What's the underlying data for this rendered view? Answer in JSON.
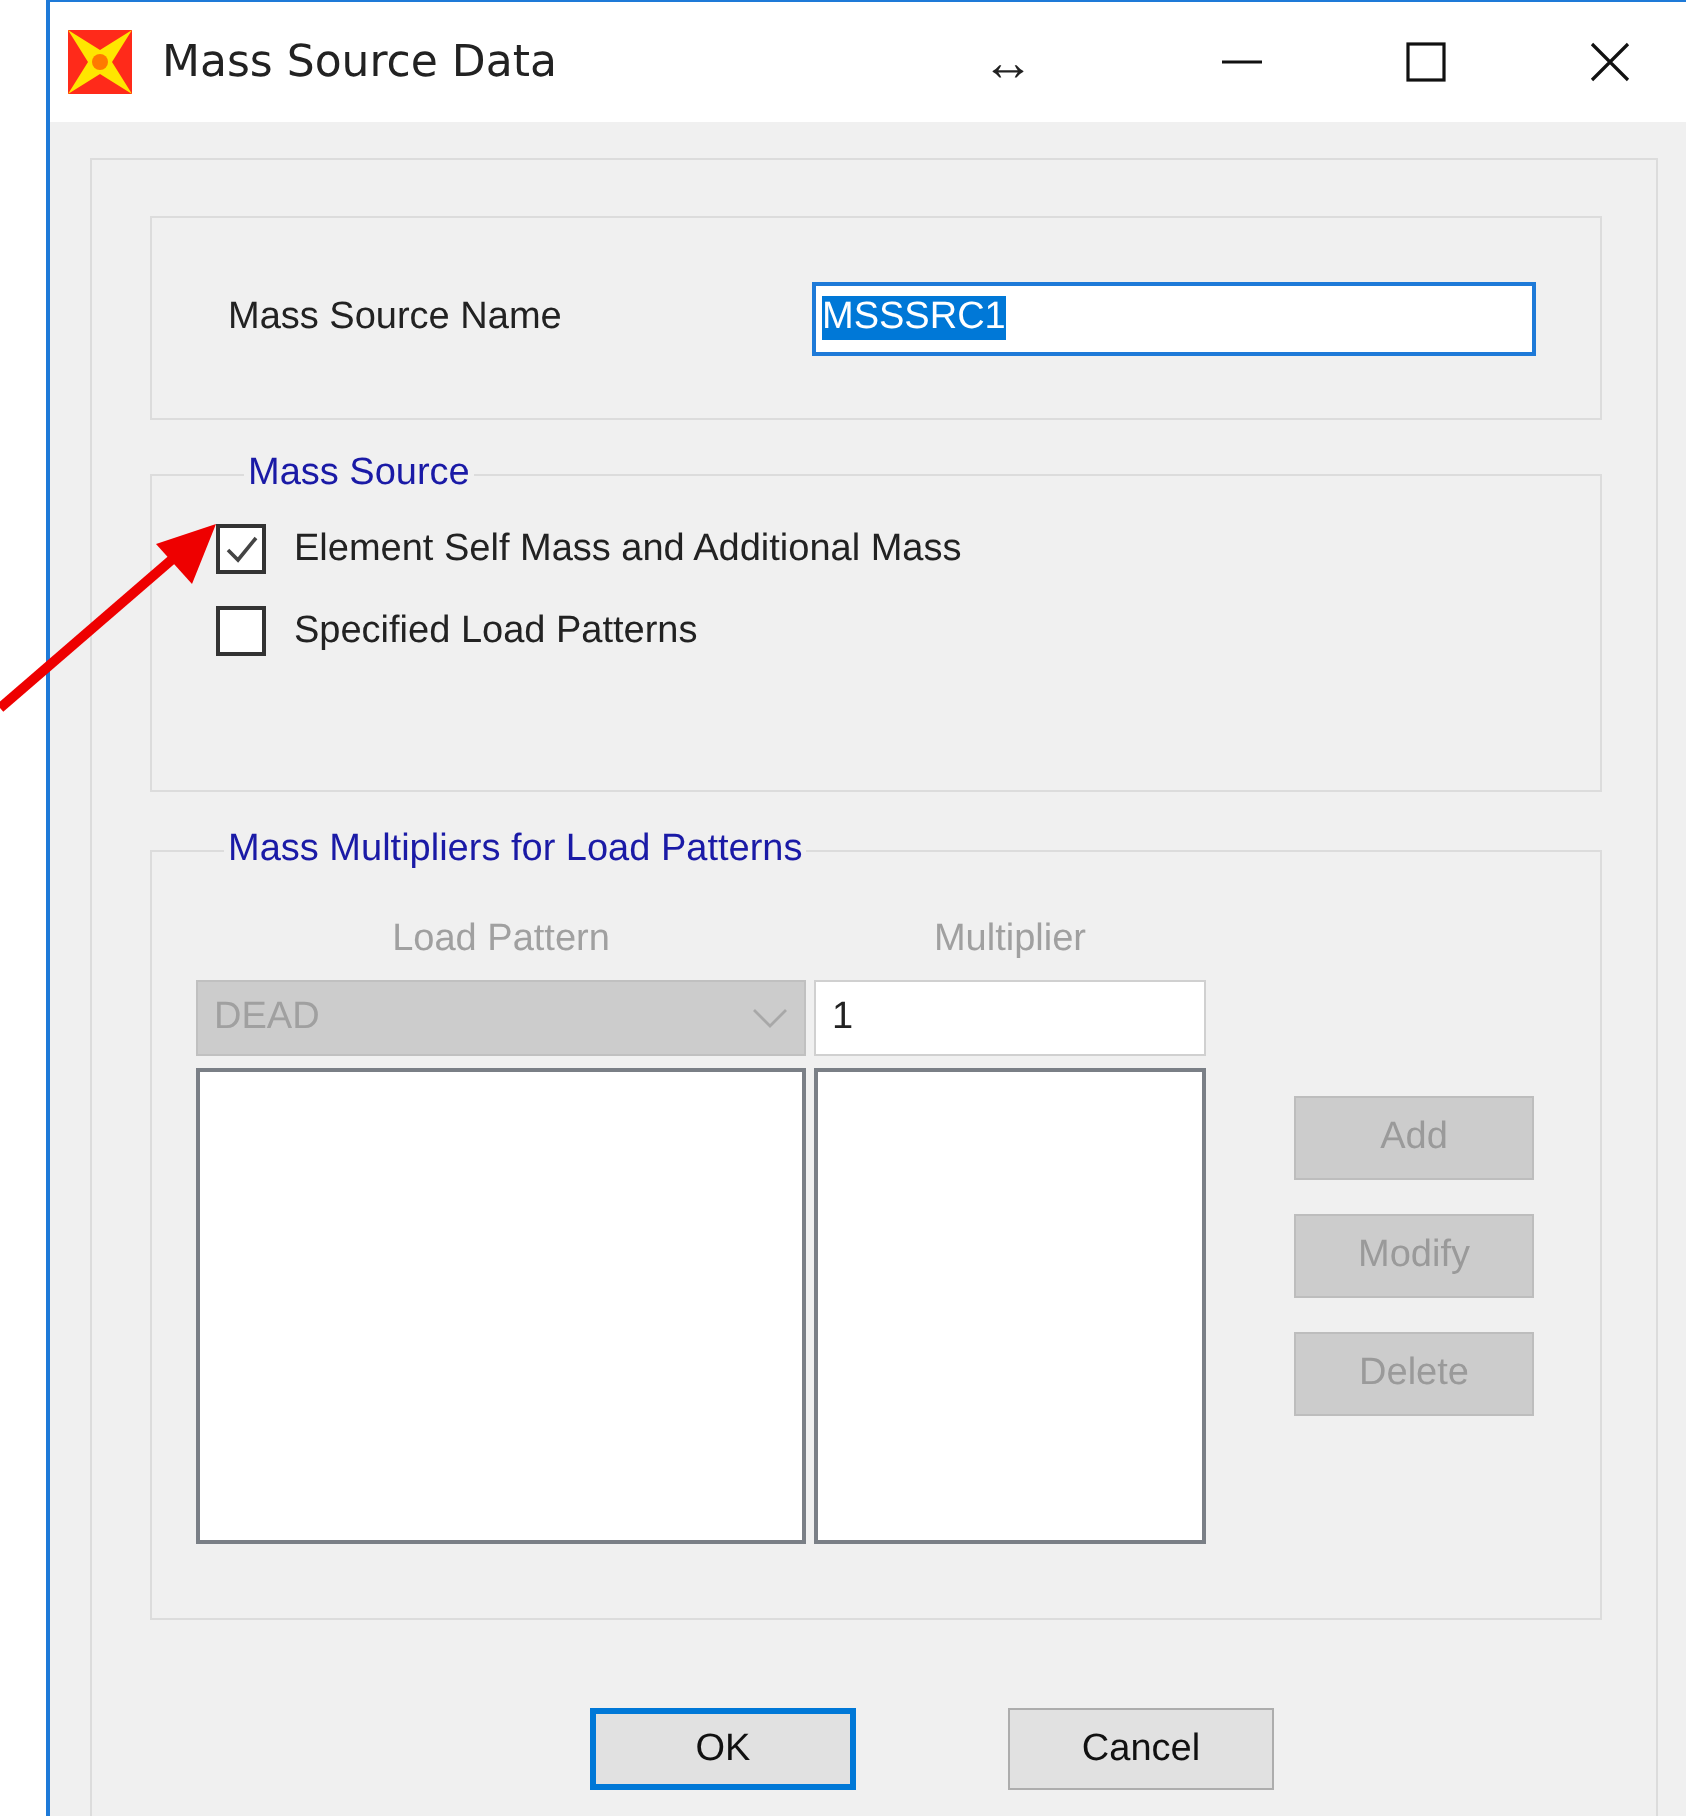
{
  "window": {
    "title": "Mass Source Data",
    "title_glyph": "↔"
  },
  "name_group": {
    "label": "Mass Source Name",
    "value": "MSSSRC1",
    "value_selected": true
  },
  "mass_source": {
    "title": "Mass Source",
    "options": [
      {
        "label": "Element Self Mass and Additional Mass",
        "checked": true
      },
      {
        "label": "Specified Load Patterns",
        "checked": false
      }
    ]
  },
  "multipliers": {
    "title": "Mass Multipliers for Load Patterns",
    "disabled": true,
    "columns": [
      "Load Pattern",
      "Multiplier"
    ],
    "load_pattern": "DEAD",
    "multiplier": "1",
    "buttons": [
      {
        "label": "Add",
        "disabled": true
      },
      {
        "label": "Modify",
        "disabled": true
      },
      {
        "label": "Delete",
        "disabled": true
      }
    ]
  },
  "buttons": [
    {
      "label": "OK",
      "default": true
    },
    {
      "label": "Cancel",
      "default": false
    }
  ]
}
